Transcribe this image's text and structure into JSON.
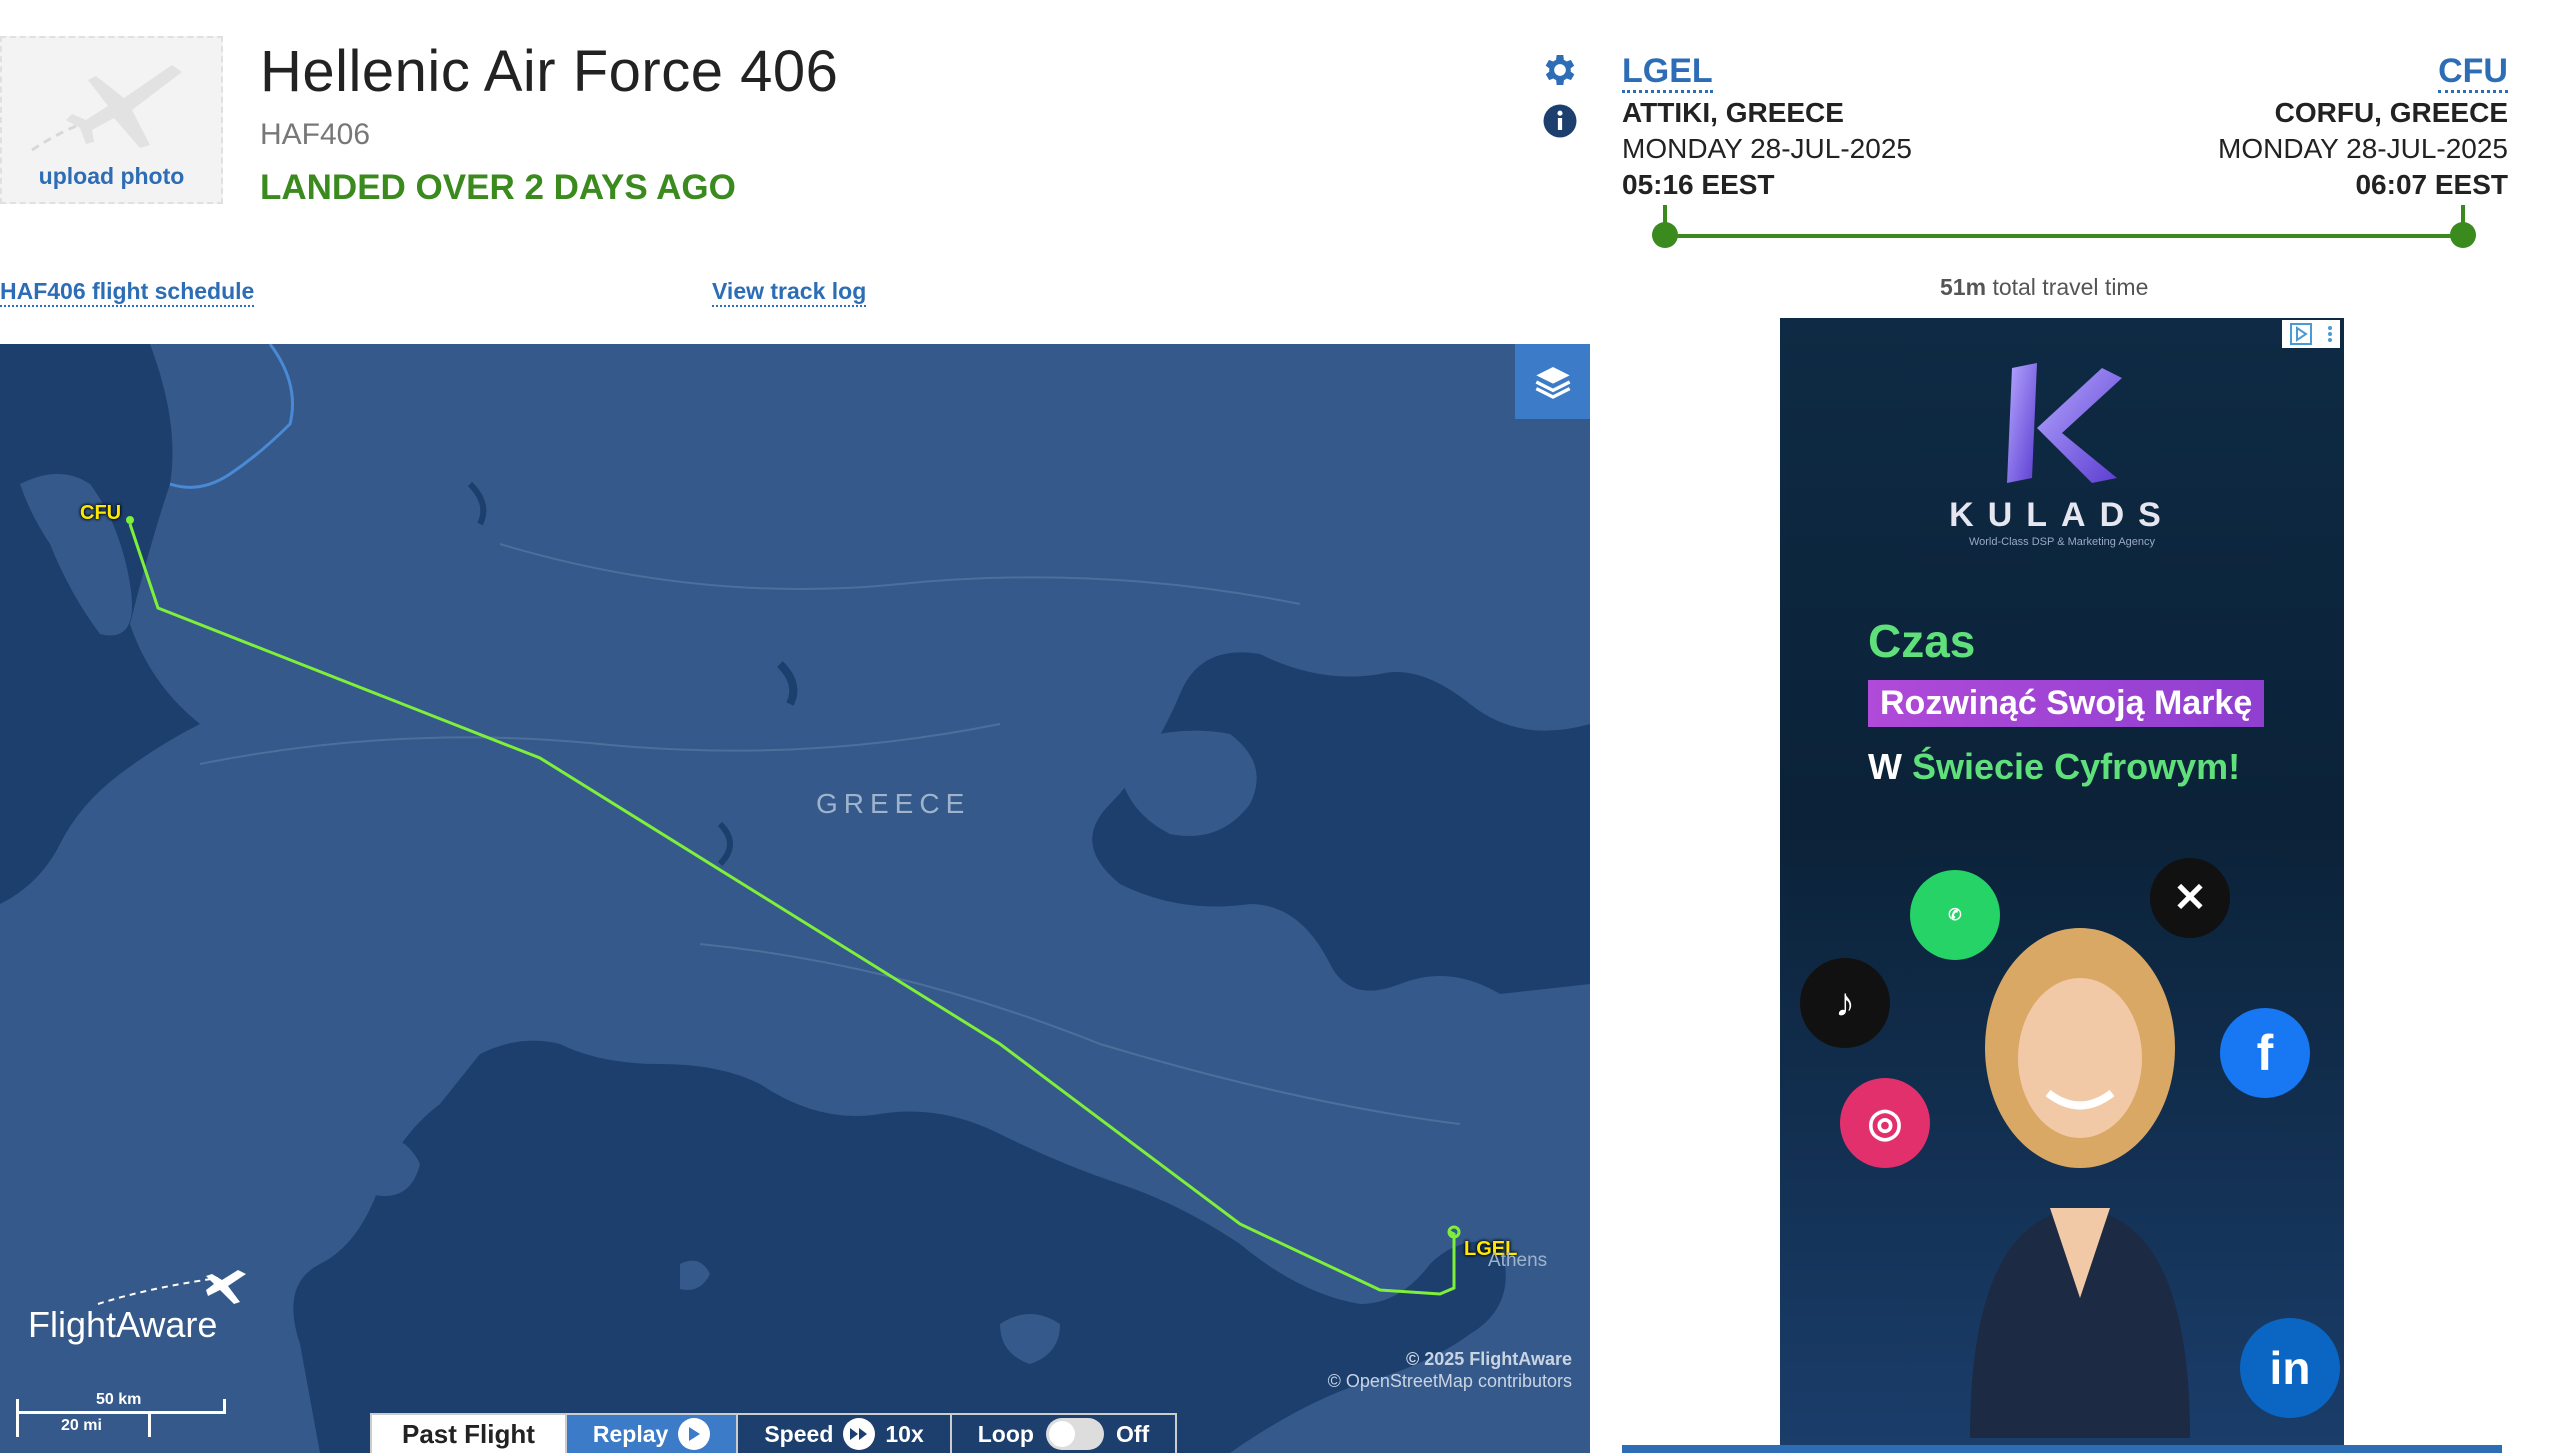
{
  "header": {
    "upload_photo": "upload photo",
    "flight_name": "Hellenic Air Force 406",
    "ident": "HAF406",
    "status": "LANDED OVER 2 DAYS AGO"
  },
  "links": {
    "schedule": "HAF406 flight schedule",
    "track_log": "View track log"
  },
  "route": {
    "origin": {
      "code": "LGEL",
      "location": "ATTIKI, GREECE",
      "date": "MONDAY 28-JUL-2025",
      "time": "05:16 EEST"
    },
    "destination": {
      "code": "CFU",
      "location": "CORFU, GREECE",
      "date": "MONDAY 28-JUL-2025",
      "time": "06:07 EEST"
    },
    "travel_time_value": "51m",
    "travel_time_label": "total travel time"
  },
  "map": {
    "country": "GREECE",
    "origin_label": "LGEL",
    "destination_label": "CFU",
    "city": "Athens",
    "copyright_1": "© 2025 FlightAware",
    "copyright_2": "© OpenStreetMap contributors",
    "logo": "FlightAware",
    "scale_km": "50 km",
    "scale_mi": "20 mi",
    "track_color": "#7ef03a",
    "map_color": "#1d3f6e"
  },
  "controls": {
    "past_flight": "Past Flight",
    "replay": "Replay",
    "speed": "Speed",
    "speed_value": "10x",
    "loop": "Loop",
    "loop_state": "Off"
  },
  "ad": {
    "brand": "KULADS",
    "tagline": "World-Class DSP & Marketing Agency",
    "line1": "Czas",
    "line2": "Rozwinąć Swoją Markę",
    "line3_a": "W",
    "line3_b": "Świecie Cyfrowym!"
  }
}
